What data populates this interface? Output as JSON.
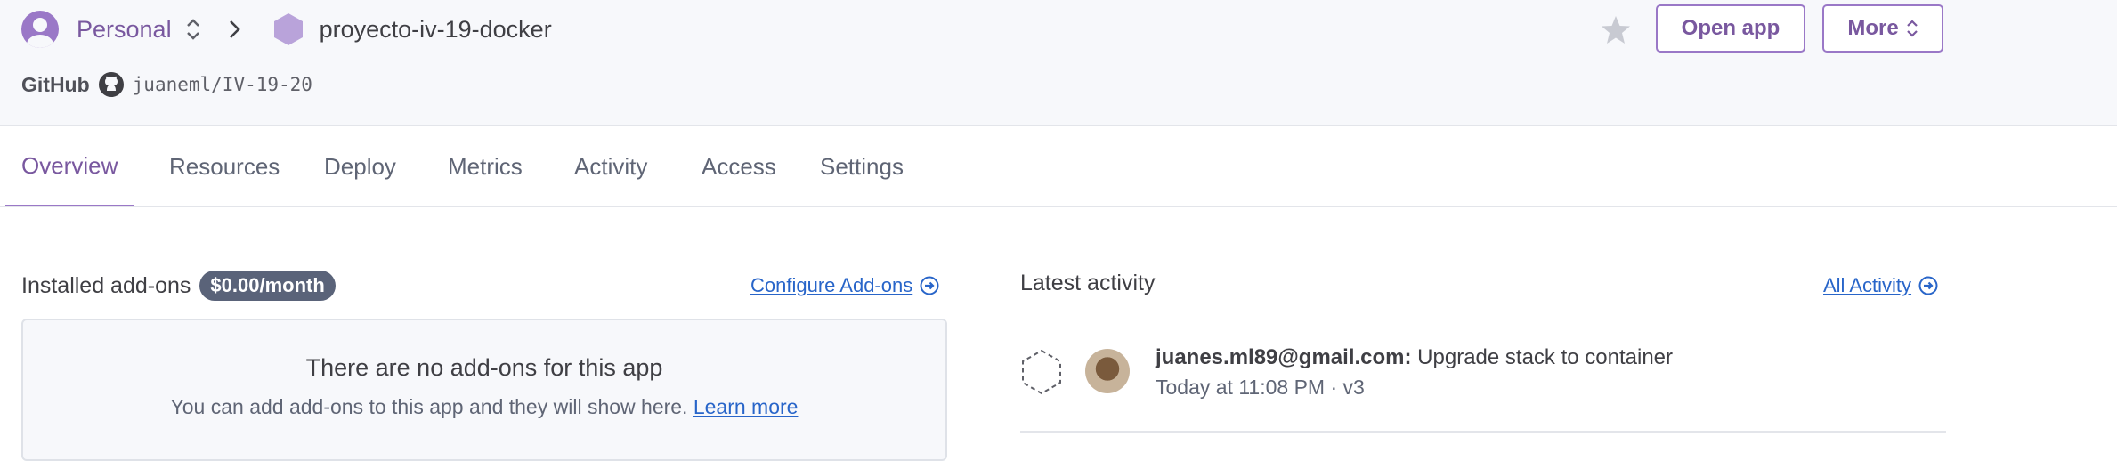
{
  "breadcrumb": {
    "account": "Personal",
    "app_name": "proyecto-iv-19-docker"
  },
  "github": {
    "label": "GitHub",
    "repo": "juaneml/IV-19-20"
  },
  "actions": {
    "open_app": "Open app",
    "more": "More"
  },
  "tabs": [
    {
      "label": "Overview",
      "active": true
    },
    {
      "label": "Resources"
    },
    {
      "label": "Deploy"
    },
    {
      "label": "Metrics"
    },
    {
      "label": "Activity"
    },
    {
      "label": "Access"
    },
    {
      "label": "Settings"
    }
  ],
  "addons": {
    "title": "Installed add-ons",
    "price": "$0.00/month",
    "configure_link": "Configure Add-ons",
    "empty_title": "There are no add-ons for this app",
    "empty_text": "You can add add-ons to this app and they will show here.",
    "learn_more": "Learn more"
  },
  "latest_activity": {
    "title": "Latest activity",
    "all_link": "All Activity",
    "items": [
      {
        "user": "juanes.ml89@gmail.com:",
        "action": "Upgrade stack to container",
        "meta": "Today at 11:08 PM · v3"
      }
    ]
  },
  "colors": {
    "brand": "#79589f",
    "link": "#2865c9",
    "badge": "#5a6379"
  }
}
